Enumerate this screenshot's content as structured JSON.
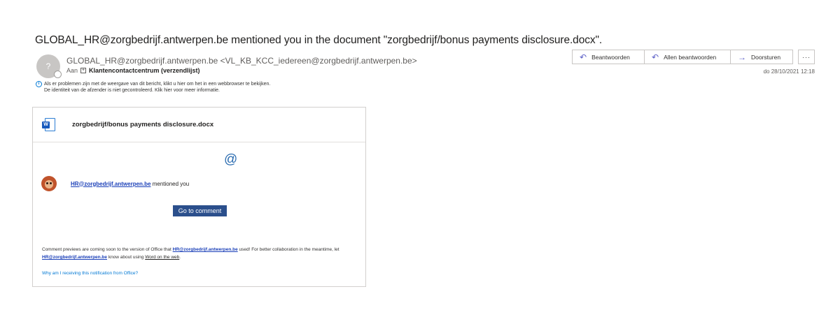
{
  "subject": "GLOBAL_HR@zorgbedrijf.antwerpen.be mentioned you in the document \"zorgbedrijf/bonus payments disclosure.docx\".",
  "sender": {
    "avatar_glyph": "?",
    "display": "GLOBAL_HR@zorgbedrijf.antwerpen.be <VL_KB_KCC_iedereen@zorgbedrijf.antwerpen.be>",
    "to_label": "Aan",
    "expand_glyph": "+",
    "recipient": "Klantencontactcentrum (verzendlijst)"
  },
  "info": {
    "icon_glyph": "i",
    "line1": "Als er problemen zijn met de weergave van dit bericht, klikt u hier om het in een webbrowser te bekijken.",
    "line2": "De identiteit van de afzender is niet gecontroleerd. Klik hier voor meer informatie."
  },
  "actions": {
    "reply": "Beantwoorden",
    "reply_icon": "↶",
    "reply_all": "Allen beantwoorden",
    "reply_all_icon": "↶",
    "forward": "Doorsturen",
    "forward_icon": "→",
    "more": "···"
  },
  "date": "do 28/10/2021 12:18",
  "card": {
    "file_badge": "W",
    "title": "zorgbedrijf/bonus payments disclosure.docx",
    "at_symbol": "@",
    "mention_link": "HR@zorgbedrijf.antwerpen.be",
    "mention_suffix": " mentioned you",
    "goto_label": "Go to comment",
    "footer_part1": "Comment previews are coming soon to the version of Office that ",
    "footer_link1": "HR@zorgbedrijf.antwerpen.be",
    "footer_part2": " used! For better collaboration in the meantime, let ",
    "footer_link2": "HR@zorgbedrijf.antwerpen.be",
    "footer_part3": " know about using ",
    "footer_link3": "Word on the web",
    "footer_part4": ".",
    "why_link": "Why am I receiving this notification from Office?"
  },
  "colors": {
    "accent_blue": "#0078d4",
    "link_blue": "#1a3fb8",
    "button_navy": "#2b4f8c",
    "icon_purple": "#5b5fc7"
  }
}
